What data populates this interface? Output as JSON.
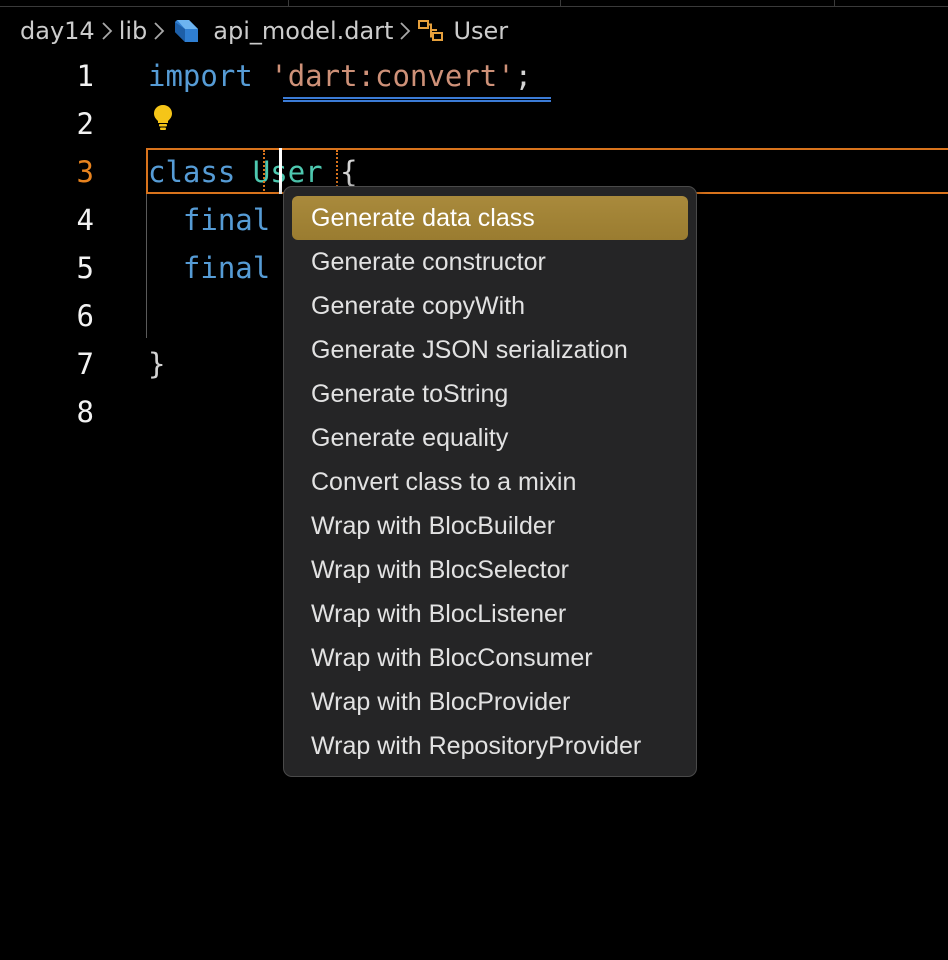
{
  "breadcrumb": {
    "items": [
      "day14",
      "lib",
      "api_model.dart",
      "User"
    ]
  },
  "editor": {
    "lines": [
      {
        "number": "1"
      },
      {
        "number": "2"
      },
      {
        "number": "3"
      },
      {
        "number": "4"
      },
      {
        "number": "5"
      },
      {
        "number": "6"
      },
      {
        "number": "7"
      },
      {
        "number": "8"
      }
    ],
    "tokens": {
      "import_kw": "import",
      "import_str": "'dart:convert'",
      "import_semi": ";",
      "class_kw": "class",
      "class_name": "User",
      "open_brace": "{",
      "final_kw_1": "final",
      "final_kw_2": "final",
      "close_brace": "}"
    },
    "active_line": "3"
  },
  "code_actions": {
    "items": [
      "Generate data class",
      "Generate constructor",
      "Generate copyWith",
      "Generate JSON serialization",
      "Generate toString",
      "Generate equality",
      "Convert class to a mixin",
      "Wrap with BlocBuilder",
      "Wrap with BlocSelector",
      "Wrap with BlocListener",
      "Wrap with BlocConsumer",
      "Wrap with BlocProvider",
      "Wrap with RepositoryProvider"
    ],
    "selected_index": 0
  },
  "icons": {
    "dart_file": "dart-icon",
    "class_symbol": "class-symbol-icon",
    "quick_fix": "lightbulb-icon",
    "separator": "chevron-right-icon"
  },
  "colors": {
    "background": "#000000",
    "keyword": "#569cd6",
    "string": "#ce9178",
    "type": "#4ec9b0",
    "active_line_number": "#e8831e",
    "current_line_border": "#d9731c",
    "menu_background": "#252526",
    "menu_selected": "#a98a3c",
    "lightbulb": "#f5c518"
  }
}
